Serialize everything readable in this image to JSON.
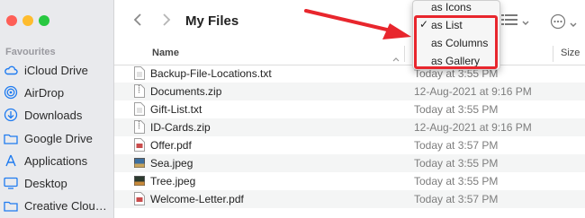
{
  "sidebar": {
    "section_title": "Favourites",
    "items": [
      {
        "label": "iCloud Drive",
        "icon": "cloud-icon"
      },
      {
        "label": "AirDrop",
        "icon": "airdrop-icon"
      },
      {
        "label": "Downloads",
        "icon": "download-icon"
      },
      {
        "label": "Google Drive",
        "icon": "folder-icon"
      },
      {
        "label": "Applications",
        "icon": "applications-icon"
      },
      {
        "label": "Desktop",
        "icon": "desktop-icon"
      },
      {
        "label": "Creative Clou…",
        "icon": "folder-icon"
      }
    ]
  },
  "toolbar": {
    "title": "My Files"
  },
  "columns": {
    "name": "Name",
    "size": "Size"
  },
  "files": [
    {
      "name": "Backup-File-Locations.txt",
      "date": "Today at 3:55 PM",
      "type": "txt"
    },
    {
      "name": "Documents.zip",
      "date": "12-Aug-2021 at 9:16 PM",
      "type": "zip"
    },
    {
      "name": "Gift-List.txt",
      "date": "Today at 3:55 PM",
      "type": "txt"
    },
    {
      "name": "ID-Cards.zip",
      "date": "12-Aug-2021 at 9:16 PM",
      "type": "zip"
    },
    {
      "name": "Offer.pdf",
      "date": "Today at 3:57 PM",
      "type": "pdf"
    },
    {
      "name": "Sea.jpeg",
      "date": "Today at 3:55 PM",
      "type": "jpeg"
    },
    {
      "name": "Tree.jpeg",
      "date": "Today at 3:55 PM",
      "type": "jpeg"
    },
    {
      "name": "Welcome-Letter.pdf",
      "date": "Today at 3:57 PM",
      "type": "pdf"
    }
  ],
  "view_menu": {
    "items": [
      {
        "label": "as Icons",
        "checked": false
      },
      {
        "label": "as List",
        "checked": true
      },
      {
        "label": "as Columns",
        "checked": false
      },
      {
        "label": "as Gallery",
        "checked": false
      }
    ],
    "check_mark": "✓"
  },
  "colors": {
    "sidebar_bg": "#e9eaed",
    "accent": "#1f7bf0",
    "highlight": "#e8262d",
    "traffic_close": "#fe5f57",
    "traffic_min": "#febc2e",
    "traffic_max": "#28c840"
  }
}
